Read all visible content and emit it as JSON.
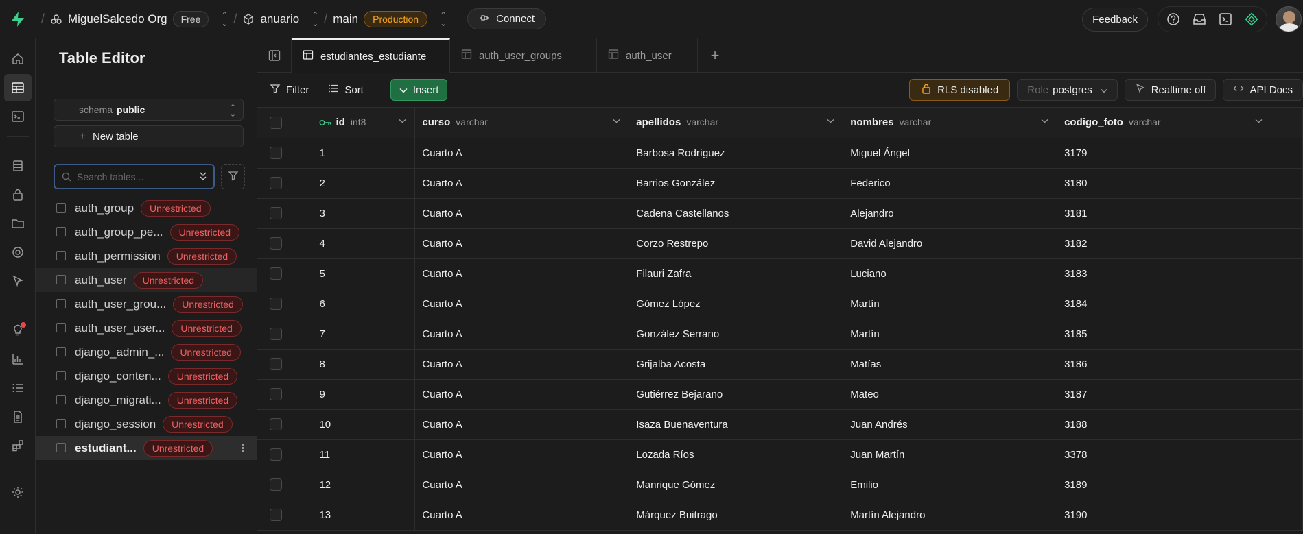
{
  "topbar": {
    "org": "MiguelSalcedo Org",
    "plan": "Free",
    "project": "anuario",
    "branch": "main",
    "env": "Production",
    "connect": "Connect",
    "feedback": "Feedback"
  },
  "sidebar": {
    "title": "Table Editor",
    "schema_label": "schema",
    "schema_value": "public",
    "new_table": "New table",
    "search_placeholder": "Search tables...",
    "tables": [
      {
        "name": "auth_group",
        "badge": "Unrestricted"
      },
      {
        "name": "auth_group_pe...",
        "badge": "Unrestricted"
      },
      {
        "name": "auth_permission",
        "badge": "Unrestricted"
      },
      {
        "name": "auth_user",
        "badge": "Unrestricted"
      },
      {
        "name": "auth_user_grou...",
        "badge": "Unrestricted"
      },
      {
        "name": "auth_user_user...",
        "badge": "Unrestricted"
      },
      {
        "name": "django_admin_...",
        "badge": "Unrestricted"
      },
      {
        "name": "django_conten...",
        "badge": "Unrestricted"
      },
      {
        "name": "django_migrati...",
        "badge": "Unrestricted"
      },
      {
        "name": "django_session",
        "badge": "Unrestricted"
      },
      {
        "name": "estudiant...",
        "badge": "Unrestricted"
      }
    ]
  },
  "tabs": [
    {
      "label": "estudiantes_estudiante"
    },
    {
      "label": "auth_user_groups"
    },
    {
      "label": "auth_user"
    }
  ],
  "toolbar": {
    "filter": "Filter",
    "sort": "Sort",
    "insert": "Insert",
    "rls": "RLS disabled",
    "role_label": "Role",
    "role_value": "postgres",
    "realtime": "Realtime off",
    "api_docs": "API Docs"
  },
  "grid": {
    "columns": [
      {
        "name": "id",
        "type": "int8"
      },
      {
        "name": "curso",
        "type": "varchar"
      },
      {
        "name": "apellidos",
        "type": "varchar"
      },
      {
        "name": "nombres",
        "type": "varchar"
      },
      {
        "name": "codigo_foto",
        "type": "varchar"
      }
    ],
    "rows": [
      [
        "1",
        "Cuarto A",
        "Barbosa Rodríguez",
        "Miguel Ángel",
        "3179"
      ],
      [
        "2",
        "Cuarto A",
        "Barrios González",
        "Federico",
        "3180"
      ],
      [
        "3",
        "Cuarto A",
        "Cadena Castellanos",
        "Alejandro",
        "3181"
      ],
      [
        "4",
        "Cuarto A",
        "Corzo Restrepo",
        "David Alejandro",
        "3182"
      ],
      [
        "5",
        "Cuarto A",
        "Filauri Zafra",
        "Luciano",
        "3183"
      ],
      [
        "6",
        "Cuarto A",
        "Gómez López",
        "Martín",
        "3184"
      ],
      [
        "7",
        "Cuarto A",
        "González Serrano",
        "Martín",
        "3185"
      ],
      [
        "8",
        "Cuarto A",
        "Grijalba Acosta",
        "Matías",
        "3186"
      ],
      [
        "9",
        "Cuarto A",
        "Gutiérrez Bejarano",
        "Mateo",
        "3187"
      ],
      [
        "10",
        "Cuarto A",
        "Isaza Buenaventura",
        "Juan Andrés",
        "3188"
      ],
      [
        "11",
        "Cuarto A",
        "Lozada Ríos",
        "Juan Martín",
        "3378"
      ],
      [
        "12",
        "Cuarto A",
        "Manrique Gómez",
        "Emilio",
        "3189"
      ],
      [
        "13",
        "Cuarto A",
        "Márquez Buitrago",
        "Martín Alejandro",
        "3190"
      ]
    ]
  }
}
